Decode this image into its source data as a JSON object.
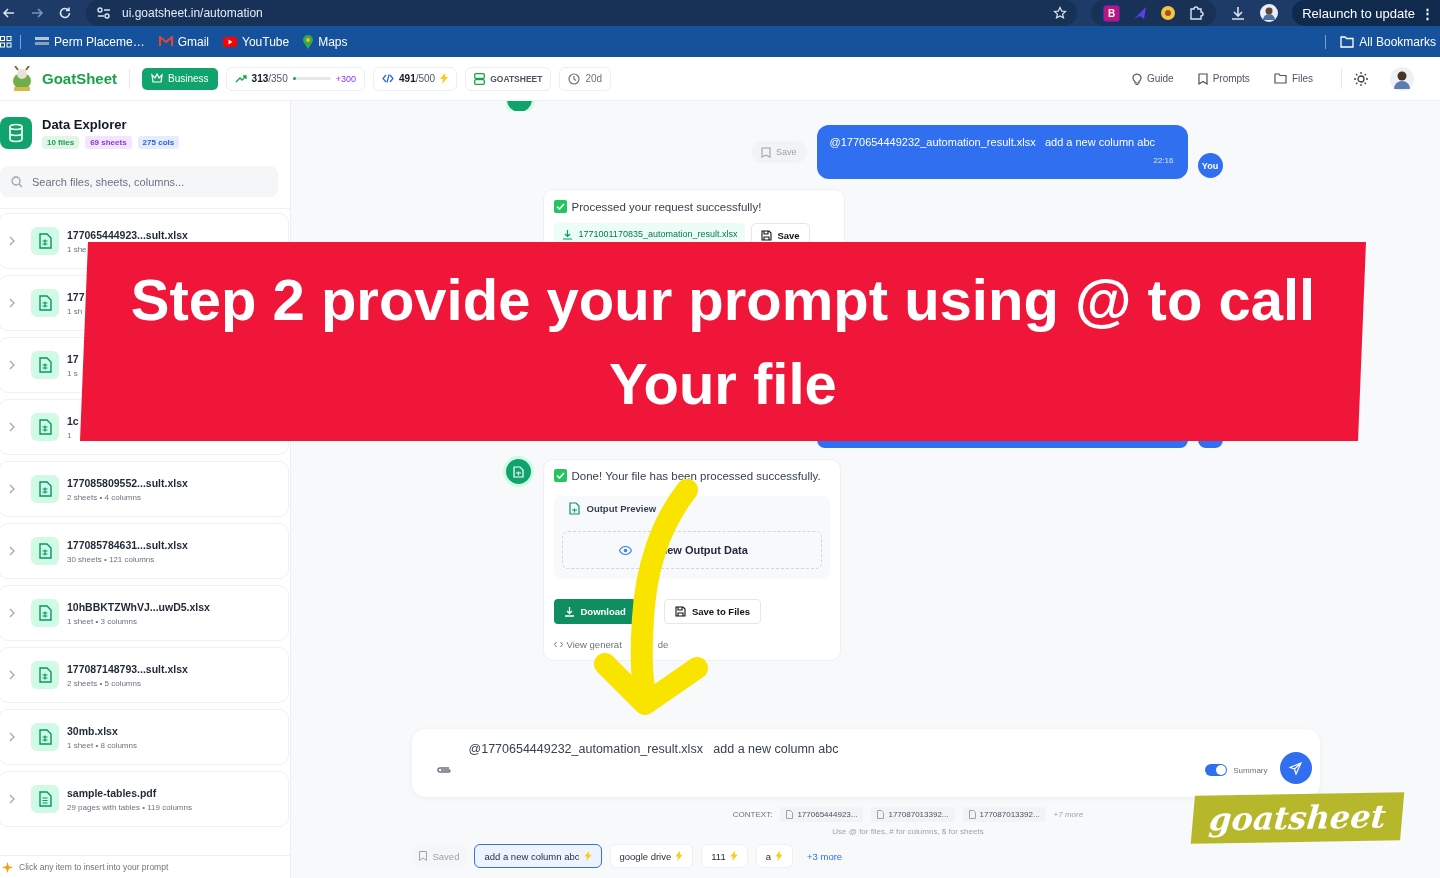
{
  "browser": {
    "url": "ui.goatsheet.in/automation",
    "relaunch": "Relaunch to update",
    "menu": "⋮",
    "extensions": [
      "B"
    ],
    "bookmarks": [
      "Perm Placeme…",
      "Gmail",
      "YouTube",
      "Maps"
    ],
    "all_bookmarks": "All Bookmarks"
  },
  "header": {
    "brand": "GoatSheet",
    "plan": "Business",
    "credits": {
      "used": "313",
      "total": "/350",
      "level": 0.05,
      "bonus": "+300"
    },
    "calls": {
      "used": "491",
      "total": "/500"
    },
    "workspace": "GOATSHEET",
    "days": "20d",
    "nav": [
      "Guide",
      "Prompts",
      "Files"
    ]
  },
  "sidebar": {
    "title": "Data Explorer",
    "tags": [
      {
        "label": "10 files",
        "color": "#16a34a"
      },
      {
        "label": "69 sheets",
        "color": "#9333ea"
      },
      {
        "label": "275 cols",
        "color": "#2563eb"
      }
    ],
    "search": {
      "placeholder": "Search files, sheets, columns..."
    },
    "files": [
      {
        "name": "177065444923...sult.xlsx",
        "meta": "1 she",
        "kind": "sheet"
      },
      {
        "name": "177",
        "meta": "1 sh",
        "kind": "sheet"
      },
      {
        "name": "17",
        "meta": "1 s",
        "kind": "sheet"
      },
      {
        "name": "1c",
        "meta": "1",
        "kind": "sheet"
      },
      {
        "name": "177085809552...sult.xlsx",
        "meta": "2 sheets • 4 columns",
        "kind": "sheet"
      },
      {
        "name": "177085784631...sult.xlsx",
        "meta": "30 sheets • 121 columns",
        "kind": "sheet"
      },
      {
        "name": "10hBBKTZWhVJ...uwD5.xlsx",
        "meta": "1 sheet • 3 columns",
        "kind": "sheet"
      },
      {
        "name": "177087148793...sult.xlsx",
        "meta": "2 sheets • 5 columns",
        "kind": "sheet"
      },
      {
        "name": "30mb.xlsx",
        "meta": "1 sheet • 8 columns",
        "kind": "sheet"
      },
      {
        "name": "sample-tables.pdf",
        "meta": "29 pages with tables • 119 columns",
        "kind": "pdf"
      }
    ],
    "footer": "Click any item to insert into your prompt"
  },
  "chat": {
    "user_message": {
      "save": "Save",
      "text": "@1770654449232_automation_result.xlsx   add a new column abc",
      "time": "22:16",
      "avatar": "You"
    },
    "reply_1": {
      "status": "Processed your request successfully!",
      "file": "1771001170835_automation_result.xlsx",
      "save": "Save"
    },
    "reply_2": {
      "status": "Done! Your file has been processed successfully.",
      "preview_title": "Output Preview",
      "preview_button": "iew Output Data",
      "download": "Download",
      "save_to_files": "Save to Files",
      "code_link": "View generat",
      "code_link_tail": "de"
    }
  },
  "composer": {
    "value": "@1770654449232_automation_result.xlsx   add a new column abc",
    "summary": {
      "label": "Summary",
      "on": true
    },
    "context_label": "CONTEXT:",
    "context": [
      "177065444923...",
      "177087013392...",
      "177087013392..."
    ],
    "context_more": "+7 more",
    "hint": "Use @ for files, # for columns, $ for sheets",
    "saved": "Saved",
    "suggestions": [
      {
        "label": "add a new column abc",
        "selected": true
      },
      {
        "label": "google drive",
        "selected": false
      },
      {
        "label": "111",
        "selected": false
      },
      {
        "label": "a",
        "selected": false
      }
    ],
    "more": "+3 more"
  },
  "overlay": {
    "banner": "Step 2 provide your prompt using @ to call Your file",
    "sticker": "goatsheet"
  }
}
